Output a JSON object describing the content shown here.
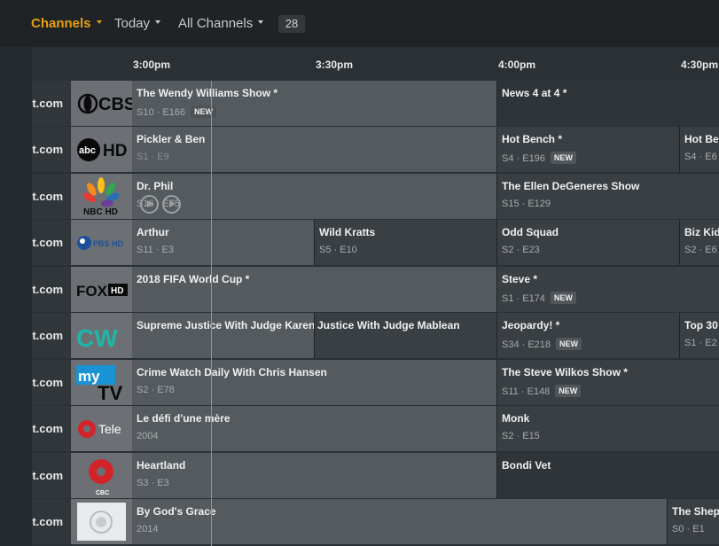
{
  "topbar": {
    "channels": "Channels",
    "today": "Today",
    "all_channels": "All Channels",
    "count": "28"
  },
  "times": [
    "3:00pm",
    "3:30pm",
    "4:00pm",
    "4:30pm"
  ],
  "rows": [
    {
      "url": "t.com",
      "logo_icon": "cbs-logo-icon",
      "programs": [
        {
          "title": "The Wendy Williams Show *",
          "sub": "S10 · E166",
          "badge": "NEW"
        },
        {
          "title": "News 4 at 4 *",
          "sub": "",
          "badge": ""
        }
      ]
    },
    {
      "url": "t.com",
      "logo_icon": "abc-hd-logo-icon",
      "programs": [
        {
          "title": "Pickler & Ben",
          "sub": "S1 · E9",
          "badge": ""
        },
        {
          "title": "Hot Bench *",
          "sub": "S4 · E196",
          "badge": "NEW"
        },
        {
          "title": "Hot Be",
          "sub": "S4 · E6",
          "badge": ""
        }
      ]
    },
    {
      "url": "t.com",
      "logo_icon": "nbc-hd-logo-icon",
      "programs": [
        {
          "title": "Dr. Phil",
          "sub": "S16 · E75",
          "badge": ""
        },
        {
          "title": "The Ellen DeGeneres Show",
          "sub": "S15 · E129",
          "badge": ""
        }
      ]
    },
    {
      "url": "t.com",
      "logo_icon": "pbs-hd-logo-icon",
      "programs": [
        {
          "title": "Arthur",
          "sub": "S11 · E3",
          "badge": ""
        },
        {
          "title": "Wild Kratts",
          "sub": "S5 · E10",
          "badge": ""
        },
        {
          "title": "Odd Squad",
          "sub": "S2 · E23",
          "badge": ""
        },
        {
          "title": "Biz Kid",
          "sub": "S2 · E6",
          "badge": ""
        }
      ]
    },
    {
      "url": "t.com",
      "logo_icon": "fox-hd-logo-icon",
      "programs": [
        {
          "title": "2018 FIFA World Cup *",
          "sub": "",
          "badge": ""
        },
        {
          "title": "Steve *",
          "sub": "S1 · E174",
          "badge": "NEW"
        }
      ]
    },
    {
      "url": "t.com",
      "logo_icon": "cw-logo-icon",
      "programs": [
        {
          "title": "Supreme Justice With Judge Karen M",
          "sub": "",
          "badge": ""
        },
        {
          "title": "Justice With Judge Mablean",
          "sub": "",
          "badge": ""
        },
        {
          "title": "Jeopardy! *",
          "sub": "S34 · E218",
          "badge": "NEW"
        },
        {
          "title": "Top 30",
          "sub": "S1 · E2",
          "badge": ""
        }
      ]
    },
    {
      "url": "t.com",
      "logo_icon": "mytv-logo-icon",
      "programs": [
        {
          "title": "Crime Watch Daily With Chris Hansen",
          "sub": "S2 · E78",
          "badge": ""
        },
        {
          "title": "The Steve Wilkos Show *",
          "sub": "S11 · E148",
          "badge": "NEW"
        }
      ]
    },
    {
      "url": "t.com",
      "logo_icon": "ici-tele-logo-icon",
      "logo_text": "Tele",
      "programs": [
        {
          "title": "Le défi d'une mère",
          "sub": "2004",
          "badge": ""
        },
        {
          "title": "Monk",
          "sub": "S2 · E15",
          "badge": ""
        }
      ]
    },
    {
      "url": "t.com",
      "logo_icon": "cbc-logo-icon",
      "logo_text": "CBC",
      "programs": [
        {
          "title": "Heartland",
          "sub": "S3 · E3",
          "badge": ""
        },
        {
          "title": "Bondi Vet",
          "sub": "",
          "badge": ""
        }
      ]
    },
    {
      "url": "t.com",
      "logo_icon": "anniversary-logo-icon",
      "programs": [
        {
          "title": "By God's Grace",
          "sub": "2014",
          "badge": ""
        },
        {
          "title": "The Sheph",
          "sub": "S0 · E1",
          "badge": ""
        }
      ]
    }
  ],
  "colors": {
    "accent": "#e5a00d",
    "now_line": "#c8921a",
    "cell_light": "#545a5e",
    "cell_dark": "#3a3f43",
    "background": "#2b3034",
    "topbar": "#1f2326"
  }
}
